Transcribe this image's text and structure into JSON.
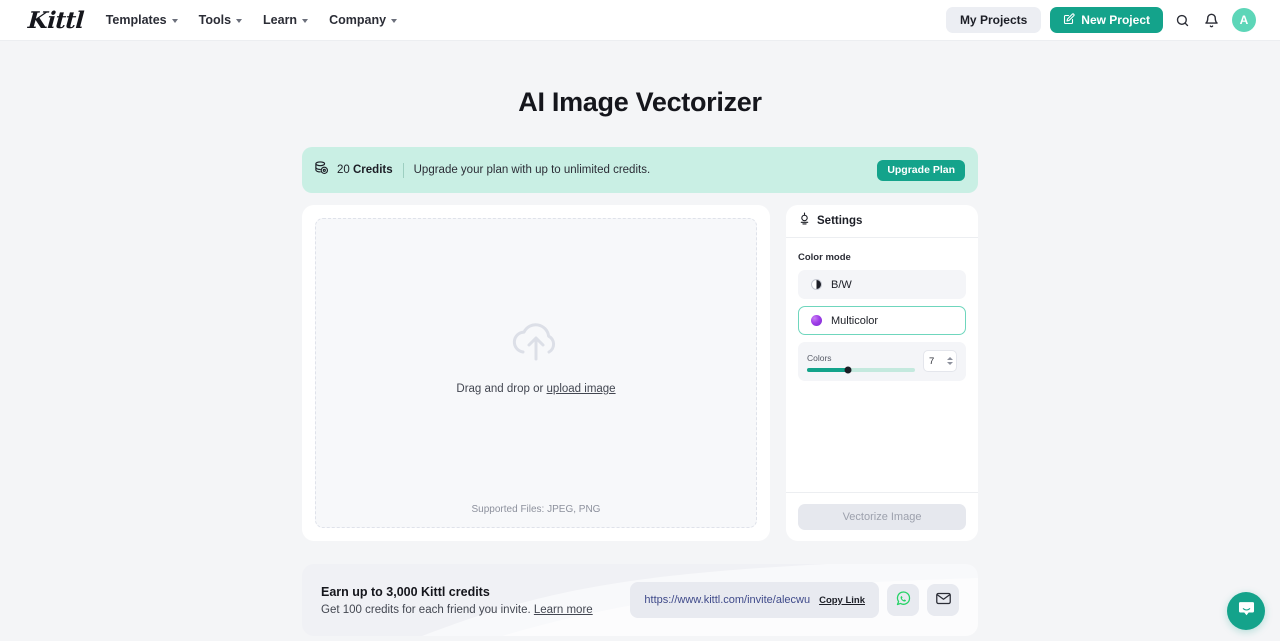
{
  "header": {
    "logo": "Kittl",
    "nav": [
      {
        "label": "Templates",
        "icon": "chevron-down-icon"
      },
      {
        "label": "Tools",
        "icon": "chevron-down-icon"
      },
      {
        "label": "Learn",
        "icon": "chevron-down-icon"
      },
      {
        "label": "Company",
        "icon": "chevron-down-icon"
      }
    ],
    "my_projects_label": "My Projects",
    "new_project_label": "New Project",
    "new_project_icon": "edit-square-icon",
    "search_icon": "search-icon",
    "notifications_icon": "bell-icon",
    "avatar_initial": "A"
  },
  "page": {
    "title": "AI Image Vectorizer"
  },
  "credits_banner": {
    "icon": "credits-coin-icon",
    "amount": "20",
    "amount_label": "Credits",
    "message": "Upgrade your plan with up to unlimited credits.",
    "upgrade_label": "Upgrade Plan",
    "background": "#c9efe4",
    "accent": "#14a38b"
  },
  "upload": {
    "icon": "cloud-upload-icon",
    "prompt_prefix": "Drag and drop or ",
    "prompt_link": "upload image",
    "supported_files": "Supported Files: JPEG, PNG"
  },
  "settings": {
    "icon": "settings-sliders-icon",
    "title": "Settings",
    "color_mode_label": "Color mode",
    "modes": [
      {
        "label": "B/W",
        "icon": "half-circle-swatch-icon",
        "selected": false
      },
      {
        "label": "Multicolor",
        "icon": "gradient-circle-swatch-icon",
        "selected": true
      }
    ],
    "colors_label": "Colors",
    "colors_value": "7",
    "slider_percent": 38,
    "vectorize_label": "Vectorize Image",
    "vectorize_disabled": true
  },
  "referral": {
    "title": "Earn up to 3,000 Kittl credits",
    "subtitle_prefix": "Get 100 credits for each friend you invite. ",
    "subtitle_link": "Learn more",
    "invite_url": "https://www.kittl.com/invite/alecwu",
    "copy_link_label": "Copy Link",
    "whatsapp_icon": "whatsapp-icon",
    "email_icon": "envelope-icon"
  },
  "chat": {
    "icon": "chat-bubble-icon"
  }
}
